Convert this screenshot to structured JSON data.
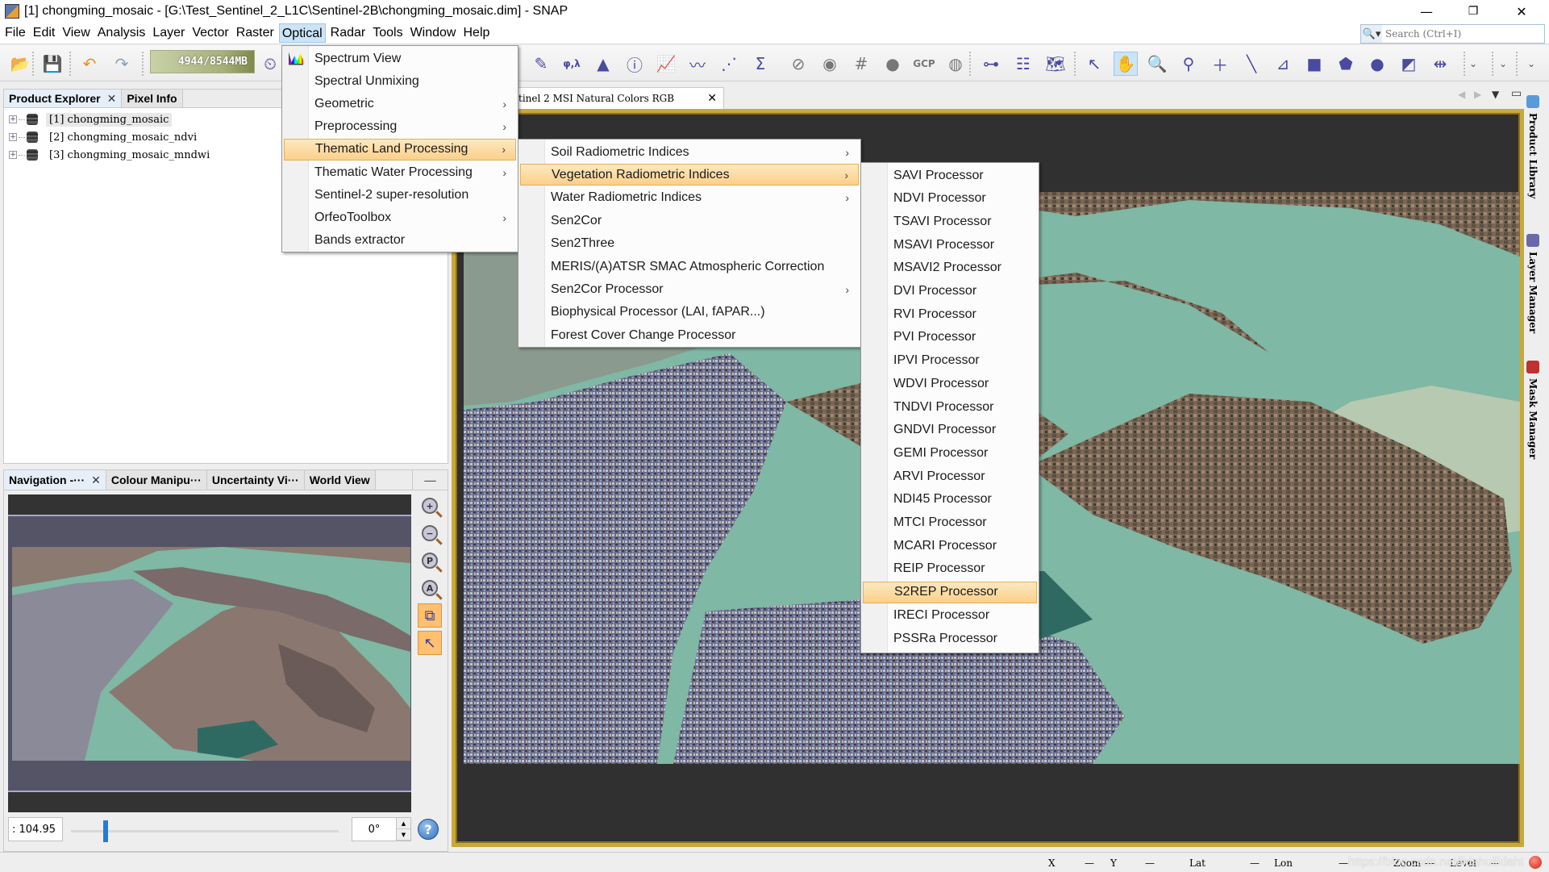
{
  "window": {
    "title": "[1] chongming_mosaic - [G:\\Test_Sentinel_2_L1C\\Sentinel-2B\\chongming_mosaic.dim] - SNAP",
    "minimize": "—",
    "restore": "❐",
    "close": "✕"
  },
  "menubar": {
    "items": [
      "File",
      "Edit",
      "View",
      "Analysis",
      "Layer",
      "Vector",
      "Raster",
      "Optical",
      "Radar",
      "Tools",
      "Window",
      "Help"
    ],
    "open_item": "Optical"
  },
  "search": {
    "placeholder": "Search (Ctrl+I)"
  },
  "toolbar": {
    "memory": "4944/8544MB",
    "icons": [
      "open-product",
      "save-product",
      "undo",
      "redo",
      "memory-gauge",
      "session",
      "draw-line",
      "wavelength",
      "histogram",
      "information",
      "time-series",
      "spectrum",
      "scatter-plot",
      "band-maths",
      "overlay-no-data",
      "overlay-pins",
      "overlay-graticule",
      "overlay-mask",
      "overlay-gcp",
      "overlay-shapes",
      "graph-builder",
      "batch-processing",
      "world-map",
      "select-tool",
      "pan-tool",
      "zoom-tool",
      "pin-placing",
      "gcp-placing",
      "line-drawing",
      "polyline-drawing",
      "rectangle-drawing",
      "polygon-drawing",
      "ellipse-drawing",
      "insert-figure",
      "range-finder"
    ],
    "gcp_label": "GCP",
    "active_tool": "pan-tool"
  },
  "product_explorer": {
    "tabs": [
      {
        "label": "Product Explorer",
        "closable": true,
        "active": true
      },
      {
        "label": "Pixel Info",
        "closable": false,
        "active": false
      }
    ],
    "products": [
      {
        "label": "[1]  chongming_mosaic",
        "selected": true
      },
      {
        "label": "[2]  chongming_mosaic_ndvi",
        "selected": false
      },
      {
        "label": "[3]  chongming_mosaic_mndwi",
        "selected": false
      }
    ]
  },
  "navigation": {
    "tabs": [
      {
        "label": "Navigation -···",
        "closable": true,
        "active": true
      },
      {
        "label": "Colour Manipu···",
        "closable": false,
        "active": false
      },
      {
        "label": "Uncertainty Vi···",
        "closable": false,
        "active": false
      },
      {
        "label": "World View",
        "closable": false,
        "active": false
      }
    ],
    "minimize": "—",
    "zoom_value": ":  104.95",
    "zoom_slider_fraction": 0.12,
    "rotation": "0°",
    "buttons": [
      "zoom-in",
      "zoom-out",
      "zoom-pixel",
      "zoom-all",
      "sync-views",
      "sync-cursor"
    ],
    "button_glyphs": [
      "+",
      "−",
      "P",
      "A"
    ],
    "help": "?"
  },
  "image_view": {
    "tab_label": "tinel 2 MSI Natural Colors RGB",
    "tab_close": "✕"
  },
  "right_sidebar": [
    {
      "label": "Product Library"
    },
    {
      "label": "Layer Manager"
    },
    {
      "label": "Mask Manager"
    }
  ],
  "status_bar": {
    "x_label": "X",
    "x_value": "—",
    "y_label": "Y",
    "y_value": "—",
    "lat_label": "Lat",
    "lat_value": "—",
    "lon_label": "Lon",
    "lon_value": "—",
    "zoom_label": "Zoom",
    "zoom_value": "—",
    "level_label": "Level",
    "level_value": "—",
    "watermark": "https://blog.csdn.net/lidahuilidaht"
  },
  "optical_menu": {
    "items": [
      {
        "label": "Spectrum View",
        "submenu": false,
        "icon": "spectrum-icon"
      },
      {
        "label": "Spectral Unmixing",
        "submenu": false
      },
      {
        "label": "Geometric",
        "submenu": true
      },
      {
        "label": "Preprocessing",
        "submenu": true
      },
      {
        "label": "Thematic Land Processing",
        "submenu": true,
        "highlighted": true
      },
      {
        "label": "Thematic Water Processing",
        "submenu": true
      },
      {
        "label": "Sentinel-2 super-resolution",
        "submenu": false
      },
      {
        "label": "OrfeoToolbox",
        "submenu": true
      },
      {
        "label": "Bands extractor",
        "submenu": false
      }
    ]
  },
  "thematic_land_menu": {
    "items": [
      {
        "label": "Soil Radiometric Indices",
        "submenu": true
      },
      {
        "label": "Vegetation Radiometric Indices",
        "submenu": true,
        "highlighted": true
      },
      {
        "label": "Water Radiometric Indices",
        "submenu": true
      },
      {
        "label": "Sen2Cor",
        "submenu": false
      },
      {
        "label": "Sen2Three",
        "submenu": false
      },
      {
        "label": "MERIS/(A)ATSR SMAC Atmospheric Correction",
        "submenu": false
      },
      {
        "label": "Sen2Cor Processor",
        "submenu": true
      },
      {
        "label": "Biophysical Processor (LAI, fAPAR...)",
        "submenu": false
      },
      {
        "label": "Forest Cover Change Processor",
        "submenu": false
      }
    ]
  },
  "vegetation_menu": {
    "items": [
      {
        "label": "SAVI Processor"
      },
      {
        "label": "NDVI Processor"
      },
      {
        "label": "TSAVI Processor"
      },
      {
        "label": "MSAVI Processor"
      },
      {
        "label": "MSAVI2 Processor"
      },
      {
        "label": "DVI Processor"
      },
      {
        "label": "RVI Processor"
      },
      {
        "label": "PVI Processor"
      },
      {
        "label": "IPVI Processor"
      },
      {
        "label": "WDVI Processor"
      },
      {
        "label": "TNDVI Processor"
      },
      {
        "label": "GNDVI Processor"
      },
      {
        "label": "GEMI Processor"
      },
      {
        "label": "ARVI Processor"
      },
      {
        "label": "NDI45 Processor"
      },
      {
        "label": "MTCI Processor"
      },
      {
        "label": "MCARI Processor"
      },
      {
        "label": "REIP Processor"
      },
      {
        "label": "S2REP Processor",
        "highlighted": true
      },
      {
        "label": "IRECI Processor"
      },
      {
        "label": "PSSRa Processor"
      }
    ]
  },
  "colors": {
    "menu_highlight": "#fbd08a",
    "image_frame": "#c8a838",
    "water": "#7fb8a4",
    "land": "#7a6a5a",
    "slider": "#1e7fd8"
  }
}
